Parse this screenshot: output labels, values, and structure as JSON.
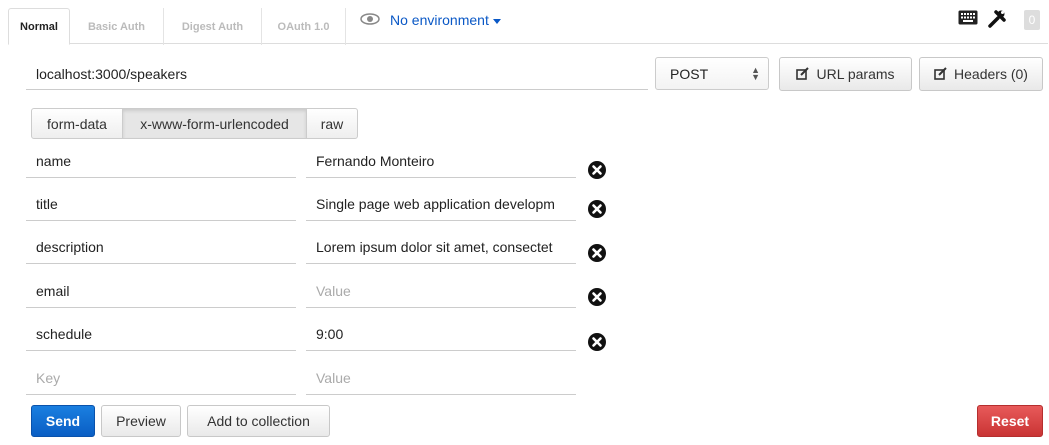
{
  "tabs": [
    {
      "label": "Normal",
      "active": true
    },
    {
      "label": "Basic Auth",
      "active": false
    },
    {
      "label": "Digest Auth",
      "active": false
    },
    {
      "label": "OAuth 1.0",
      "active": false
    }
  ],
  "environment": {
    "label": "No environment",
    "icon": "eye-icon"
  },
  "toolbar": {
    "badge_count": "0",
    "keyboard_icon": "keyboard-icon",
    "settings_icon": "wrench-icon"
  },
  "request": {
    "url": "localhost:3000/speakers",
    "method": "POST",
    "url_params_label": "URL params",
    "headers_label": "Headers (0)"
  },
  "body_types": [
    {
      "label": "form-data",
      "active": false
    },
    {
      "label": "x-www-form-urlencoded",
      "active": true
    },
    {
      "label": "raw",
      "active": false
    }
  ],
  "params": [
    {
      "key": "name",
      "value": "Fernando Monteiro",
      "value_placeholder": "Value"
    },
    {
      "key": "title",
      "value": "Single page web application developm",
      "value_placeholder": "Value"
    },
    {
      "key": "description",
      "value": "Lorem ipsum dolor sit amet, consectet",
      "value_placeholder": "Value"
    },
    {
      "key": "email",
      "value": "",
      "value_placeholder": "Value"
    },
    {
      "key": "schedule",
      "value": "9:00",
      "value_placeholder": "Value"
    }
  ],
  "new_param": {
    "key_placeholder": "Key",
    "value_placeholder": "Value"
  },
  "actions": {
    "send_label": "Send",
    "preview_label": "Preview",
    "add_to_collection_label": "Add to collection",
    "reset_label": "Reset"
  },
  "colors": {
    "accent": "#0a58c6",
    "send": "#0a5ec4",
    "reset": "#d04040"
  }
}
